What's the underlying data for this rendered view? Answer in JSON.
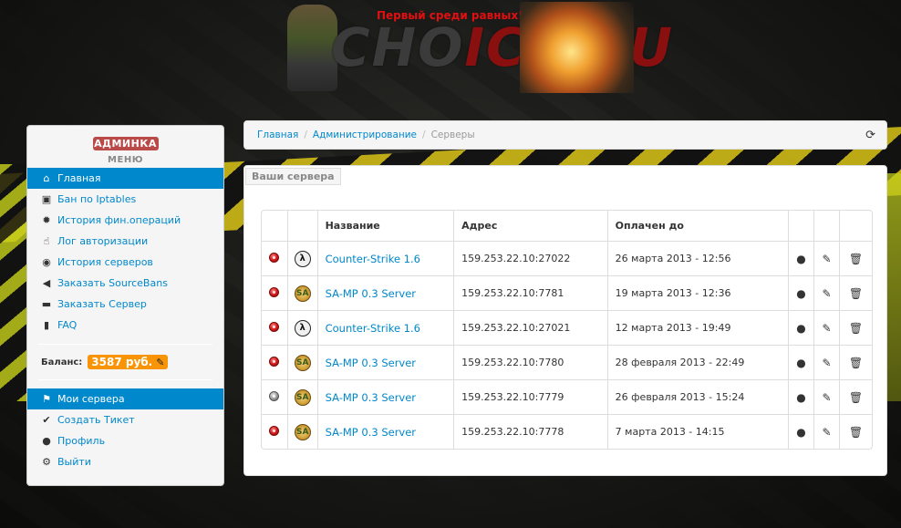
{
  "banner": {
    "tagline": "Первый среди равных!",
    "logo_part1": "CHO",
    "logo_part2": "ICE.RU"
  },
  "sidebar": {
    "badge": "АДМИНКА",
    "menu_header": "МЕНЮ",
    "items_top": [
      {
        "label": "Главная",
        "icon": "home-icon",
        "glyph": "⌂",
        "active": true
      },
      {
        "label": "Бан по Iptables",
        "icon": "lock-icon",
        "glyph": "▣",
        "active": false
      },
      {
        "label": "История фин.операций",
        "icon": "cog-icon",
        "glyph": "✹",
        "active": false
      },
      {
        "label": "Лог авторизации",
        "icon": "hand-icon",
        "glyph": "☝",
        "active": false
      },
      {
        "label": "История серверов",
        "icon": "globe-icon",
        "glyph": "◉",
        "active": false
      },
      {
        "label": "Заказать SourceBans",
        "icon": "bullhorn-icon",
        "glyph": "◀",
        "active": false
      },
      {
        "label": "Заказать Сервер",
        "icon": "hdd-icon",
        "glyph": "▬",
        "active": false
      },
      {
        "label": "FAQ",
        "icon": "book-icon",
        "glyph": "▮",
        "active": false
      }
    ],
    "balance_label": "Баланс:",
    "balance_value": "3587 руб.",
    "items_bottom": [
      {
        "label": "Мои сервера",
        "icon": "flag-icon",
        "glyph": "⚑",
        "active": true
      },
      {
        "label": "Создать Тикет",
        "icon": "check-icon",
        "glyph": "✔",
        "active": false
      },
      {
        "label": "Профиль",
        "icon": "user-icon",
        "glyph": "●",
        "active": false
      },
      {
        "label": "Выйти",
        "icon": "gear-icon",
        "glyph": "⚙",
        "active": false
      }
    ]
  },
  "breadcrumb": {
    "home": "Главная",
    "admin": "Администрирование",
    "current": "Серверы",
    "separator": "/"
  },
  "panel": {
    "title": "Ваши сервера",
    "headers": [
      "",
      "",
      "Название",
      "Адрес",
      "Оплачен до",
      "",
      "",
      ""
    ],
    "rows": [
      {
        "status": "on",
        "game": "cs",
        "game_glyph": "λ",
        "name": "Counter-Strike 1.6",
        "address": "159.253.22.10:27022",
        "paid_until": "26 марта 2013 - 12:56"
      },
      {
        "status": "on",
        "game": "samp",
        "game_glyph": "SA",
        "name": "SA-MP 0.3 Server",
        "address": "159.253.22.10:7781",
        "paid_until": "19 марта 2013 - 12:36"
      },
      {
        "status": "on",
        "game": "cs",
        "game_glyph": "λ",
        "name": "Counter-Strike 1.6",
        "address": "159.253.22.10:27021",
        "paid_until": "12 марта 2013 - 19:49"
      },
      {
        "status": "on",
        "game": "samp",
        "game_glyph": "SA",
        "name": "SA-MP 0.3 Server",
        "address": "159.253.22.10:7780",
        "paid_until": "28 февраля 2013 - 22:49"
      },
      {
        "status": "off",
        "game": "samp",
        "game_glyph": "SA",
        "name": "SA-MP 0.3 Server",
        "address": "159.253.22.10:7779",
        "paid_until": "26 февраля 2013 - 15:24"
      },
      {
        "status": "on",
        "game": "samp",
        "game_glyph": "SA",
        "name": "SA-MP 0.3 Server",
        "address": "159.253.22.10:7778",
        "paid_until": "7 марта 2013 - 14:15"
      }
    ],
    "actions": [
      {
        "icon": "user-icon",
        "glyph": "●"
      },
      {
        "icon": "pencil-icon",
        "glyph": "✎"
      },
      {
        "icon": "trash-icon",
        "glyph": "🗑"
      }
    ]
  },
  "colors": {
    "accent": "#0088cc",
    "badge_red": "#b94a48",
    "balance_orange": "#f89406"
  }
}
